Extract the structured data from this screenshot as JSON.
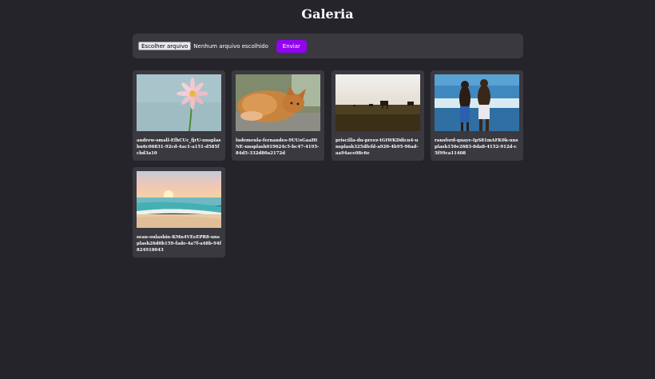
{
  "header": {
    "title": "Galeria"
  },
  "upload": {
    "choose_label": "Escolher arquivo",
    "no_file_label": "Nenhum arquivo escolhido",
    "submit_label": "Enviar"
  },
  "gallery": {
    "items": [
      {
        "caption": "andrew-small-EfhCUc_fjrU-unsplashu6c06831-92cd-4ac1-a151-d585fcbd3a10",
        "image": "pink-flower-photo"
      },
      {
        "caption": "ludemeula-fernandes-9UUoGaaHtNE-unsplash019624c5-bc47-4195-84d5-332d80a2172d",
        "image": "orange-cat-photo"
      },
      {
        "caption": "priscilla-du-preez-tGtWKDdicn4-unsplash325dfefd-a920-4b95-96ad-aa94ace08c6e",
        "image": "cattle-field-sunset-photo"
      },
      {
        "caption": "ransford-quaye-IpS81mAFK0k-unsplash150e2683-8da8-4152-912d-c5f99ca11408",
        "image": "couple-beach-photo"
      },
      {
        "caption": "sean-oulashin-KMn4VEeEPR8-unsplash26d0b159-fade-4a7f-a48b-94f824918043",
        "image": "beach-sunset-photo"
      }
    ]
  },
  "colors": {
    "background": "#25242b",
    "panel": "#3a393f",
    "accent": "#9104f0"
  }
}
